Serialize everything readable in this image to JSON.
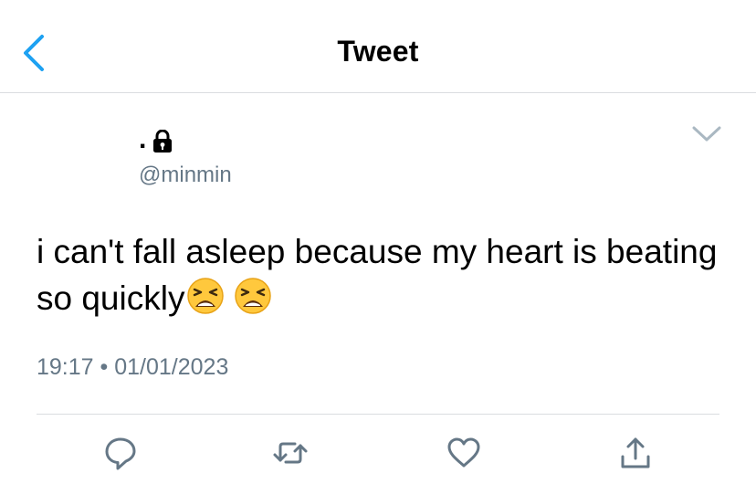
{
  "header": {
    "title": "Tweet"
  },
  "tweet": {
    "display_name": ".",
    "handle": "@minmin",
    "protected": true,
    "text": "i can't fall asleep because my heart is beating so quickly",
    "emojis": [
      "weary-face",
      "weary-face"
    ],
    "time": "19:17",
    "separator": "•",
    "date": "01/01/2023"
  },
  "actions": [
    "reply",
    "retweet",
    "like",
    "share"
  ],
  "colors": {
    "accent": "#1da1f2",
    "icon_gray": "#657786",
    "divider": "#dadde0",
    "text": "#000000"
  }
}
